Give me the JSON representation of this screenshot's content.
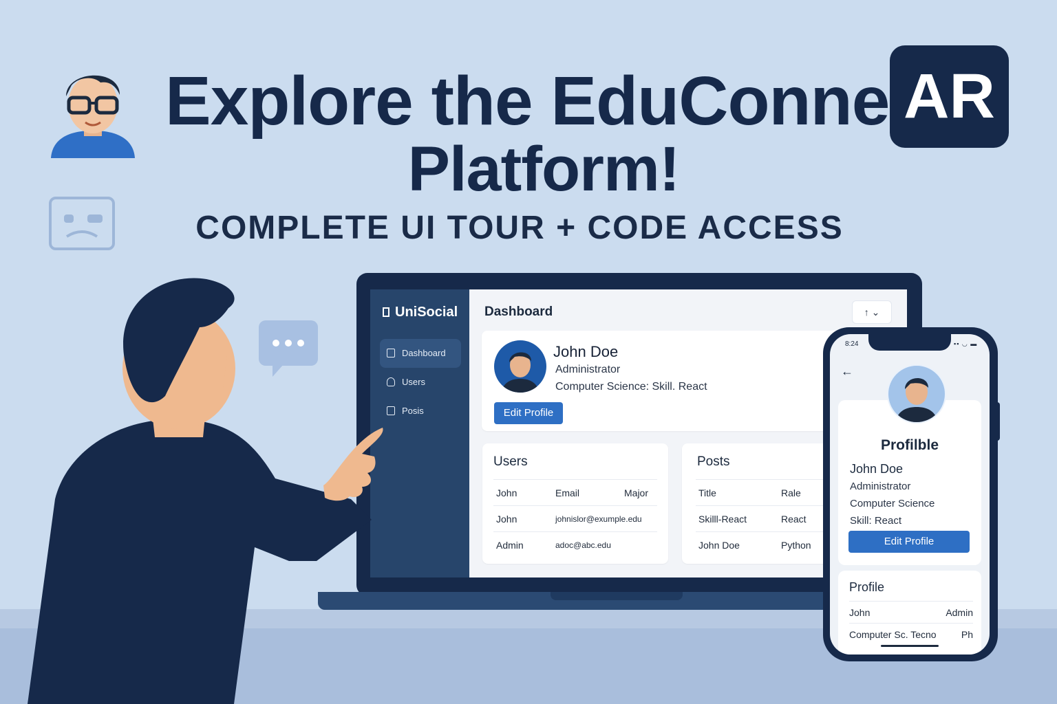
{
  "headline": {
    "line1": "Explore the EduConne",
    "badge": "AR",
    "line2": "Platform!",
    "subtitle": "COMPLETE UI TOUR + CODE ACCESS"
  },
  "laptop": {
    "brand": "UniSocial",
    "nav": [
      {
        "label": "Dashboard",
        "active": true
      },
      {
        "label": "Users",
        "active": false
      },
      {
        "label": "Posis",
        "active": false
      }
    ],
    "title": "Dashboard",
    "sort_label": "↑ ⌄",
    "profile": {
      "name": "John Doe",
      "role": "Administrator",
      "details": "Computer Science: Skill. React",
      "edit_label": "Edit Profile"
    },
    "users_card": {
      "title": "Users",
      "rows": [
        [
          "John",
          "Email",
          "Major"
        ],
        [
          "John",
          "johnislor@exumple.edu",
          ""
        ],
        [
          "Admin",
          "adoc@abc.edu",
          ""
        ]
      ]
    },
    "posts_card": {
      "title": "Posts",
      "rows": [
        [
          "Title",
          "Rale"
        ],
        [
          "Skilll-React",
          "React"
        ],
        [
          "John Doe",
          "Python"
        ]
      ]
    }
  },
  "phone": {
    "time": "8:24",
    "status": "▪▪ ◡ ▬",
    "back": "←",
    "heading": "Profilble",
    "name": "John Doe",
    "role": "Administrator",
    "major": "Computer Science",
    "skill": "Skill: React",
    "edit_label": "Edit Profile",
    "card2": {
      "title": "Profile",
      "rows": [
        [
          "John",
          "Admin"
        ],
        [
          "Computer Sc. Tecno",
          "Ph"
        ]
      ]
    }
  },
  "colors": {
    "background": "#cbdcef",
    "navy": "#16294a",
    "accent": "#2e6fc4",
    "sidebar": "#27456b"
  }
}
